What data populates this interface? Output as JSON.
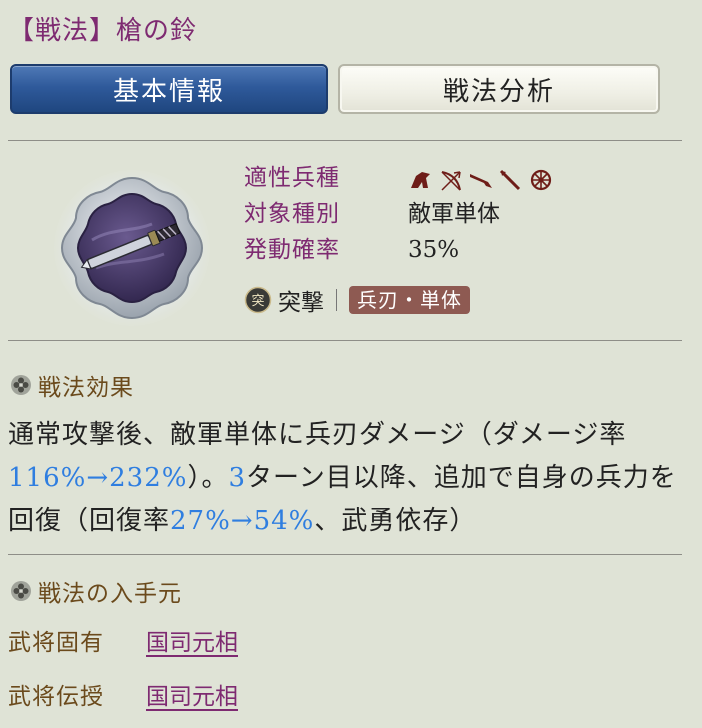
{
  "page": {
    "title": "【戦法】槍の鈴"
  },
  "tabs": [
    {
      "label": "基本情報",
      "active": true
    },
    {
      "label": "戦法分析",
      "active": false
    }
  ],
  "skill": {
    "icon": "spear-blade-icon",
    "attributes": {
      "troop_label": "適性兵種",
      "troop_icons": [
        "cavalry-icon",
        "archer-icon",
        "gun-icon",
        "spear-icon",
        "shield-icon"
      ],
      "target_label": "対象種別",
      "target_value": "敵軍単体",
      "rate_label": "発動確率",
      "rate_value": "35%"
    },
    "kind": {
      "icon": "assault-icon",
      "label": "突撃",
      "tag": "兵刃・単体"
    }
  },
  "effect_section": {
    "title": "戦法効果",
    "text_1": "通常攻撃後、敵軍単体に兵刃ダメージ（ダメージ率",
    "highlight_1": "116%→232%",
    "text_2": "）。",
    "highlight_2": "3",
    "text_3": "ターン目以降、追加で自身の兵力を回復（回復率",
    "highlight_3": "27%→54%",
    "text_4": "、武勇依存）"
  },
  "acquisition_section": {
    "title": "戦法の入手元",
    "rows": [
      {
        "label": "武将固有",
        "link": "国司元相"
      },
      {
        "label": "武将伝授",
        "link": "国司元相"
      }
    ]
  },
  "colors": {
    "background": "#dfe3d6",
    "title_purple": "#7e2a71",
    "tab_active": "#2f5a9b",
    "highlight_blue": "#2f7ee0",
    "tag_bg": "#8e5a52",
    "section_brown": "#6b4a1c"
  }
}
